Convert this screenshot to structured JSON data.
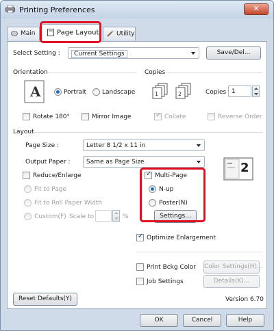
{
  "window": {
    "title": "Printing Preferences",
    "close_label": "✕"
  },
  "tabs": [
    {
      "label": "Main"
    },
    {
      "label": "Page Layout"
    },
    {
      "label": "Utility"
    }
  ],
  "select_setting": {
    "label": "Select Setting :",
    "value": "Current Settings",
    "save_button": "Save/Del..."
  },
  "orientation": {
    "title": "Orientation",
    "portrait": "Portrait",
    "landscape": "Landscape",
    "rotate": "Rotate 180°",
    "mirror": "Mirror Image",
    "selected": "Portrait"
  },
  "copies": {
    "title": "Copies",
    "label": "Copies :",
    "value": "1",
    "collate": "Collate",
    "reverse": "Reverse Order"
  },
  "layout": {
    "title": "Layout",
    "page_size_label": "Page Size :",
    "page_size_value": "Letter 8 1/2 x 11 in",
    "output_paper_label": "Output Paper :",
    "output_paper_value": "Same as Page Size",
    "reduce_enlarge": "Reduce/Enlarge",
    "fit_to_page": "Fit to Page",
    "fit_to_roll": "Fit to Roll Paper Width",
    "custom": "Custom(F)",
    "scale_to": "Scale to",
    "percent": "%",
    "multi_page": "Multi-Page",
    "nup": "N-up",
    "poster": "Poster(N)",
    "settings_button": "Settings...",
    "preview_number": "2",
    "optimize": "Optimize Enlargement",
    "print_bckg": "Print Bckg Color",
    "color_settings_button": "Color Settings(H)...",
    "job_settings": "Job Settings",
    "details_button": "Details(K)..."
  },
  "footer": {
    "reset_button": "Reset Defaults(Y)",
    "version": "Version 6.70",
    "ok": "OK",
    "cancel": "Cancel",
    "help": "Help"
  },
  "colors": {
    "highlight": "#e01020",
    "accent": "#1e6fc8"
  }
}
